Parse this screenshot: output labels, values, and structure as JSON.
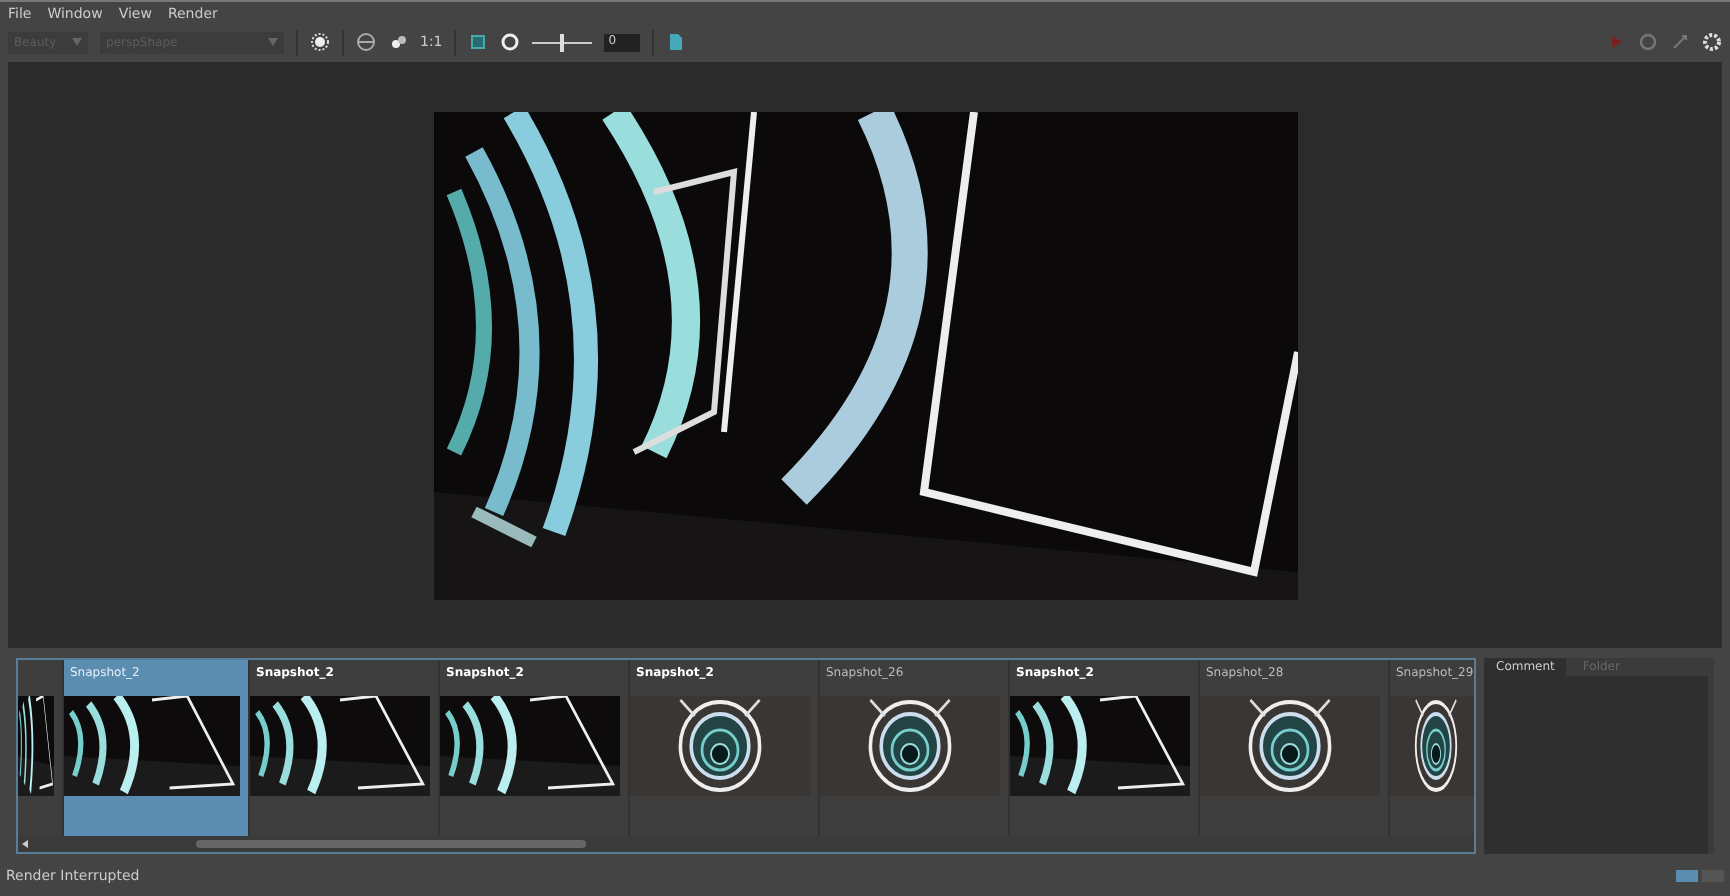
{
  "menu": [
    "File",
    "Window",
    "View",
    "Render"
  ],
  "toolbar": {
    "layer": "Beauty",
    "camera": "perspShape",
    "ratio": "1:1",
    "exposure": {
      "level": 0.5,
      "value": "0"
    }
  },
  "snapshots": [
    {
      "selected": false
    },
    {
      "label": "Snapshot_2",
      "selected": true,
      "bold": false
    },
    {
      "label": "Snapshot_2",
      "selected": false,
      "bold": true
    },
    {
      "label": "Snapshot_2",
      "selected": false,
      "bold": true
    },
    {
      "label": "Snapshot_2",
      "selected": false,
      "bold": true
    },
    {
      "label": "Snapshot_26",
      "selected": false,
      "bold": false
    },
    {
      "label": "Snapshot_2",
      "selected": false,
      "bold": true
    },
    {
      "label": "Snapshot_28",
      "selected": false,
      "bold": false
    },
    {
      "label": "Snapshot_29",
      "selected": false,
      "bold": false
    }
  ],
  "side_tabs": [
    {
      "label": "Comment",
      "selected": true
    },
    {
      "label": "Folder",
      "selected": false
    }
  ],
  "status": "Render Interrupted",
  "view_buttons": [
    {
      "selected": true
    },
    {
      "selected": false
    }
  ]
}
